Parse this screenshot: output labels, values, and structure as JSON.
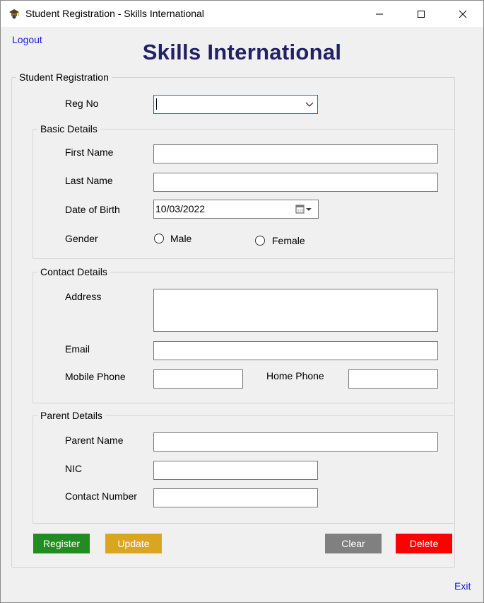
{
  "window": {
    "title": "Student Registration - Skills International",
    "icon": "student-icon"
  },
  "header": {
    "logout_label": "Logout",
    "app_title": "Skills International"
  },
  "form": {
    "group_title": "Student Registration",
    "reg_no_label": "Reg No",
    "reg_no_value": ""
  },
  "basic": {
    "title": "Basic Details",
    "first_name_label": "First Name",
    "last_name_label": "Last Name",
    "dob_label": "Date of Birth",
    "dob_value": "10/03/2022",
    "gender_label": "Gender",
    "male_label": "Male",
    "female_label": "Female"
  },
  "contact": {
    "title": "Contact Details",
    "address_label": "Address",
    "email_label": "Email",
    "mobile_label": "Mobile Phone",
    "home_label": "Home Phone"
  },
  "parent": {
    "title": "Parent Details",
    "parent_name_label": "Parent Name",
    "nic_label": "NIC",
    "contact_number_label": "Contact Number"
  },
  "actions": {
    "register": "Register",
    "update": "Update",
    "clear": "Clear",
    "delete": "Delete"
  },
  "footer": {
    "exit_label": "Exit"
  },
  "colors": {
    "register": "#228b22",
    "update": "#daa520",
    "clear": "#808080",
    "delete": "#ff0000",
    "heading": "#232166",
    "link": "#1a1adb"
  }
}
